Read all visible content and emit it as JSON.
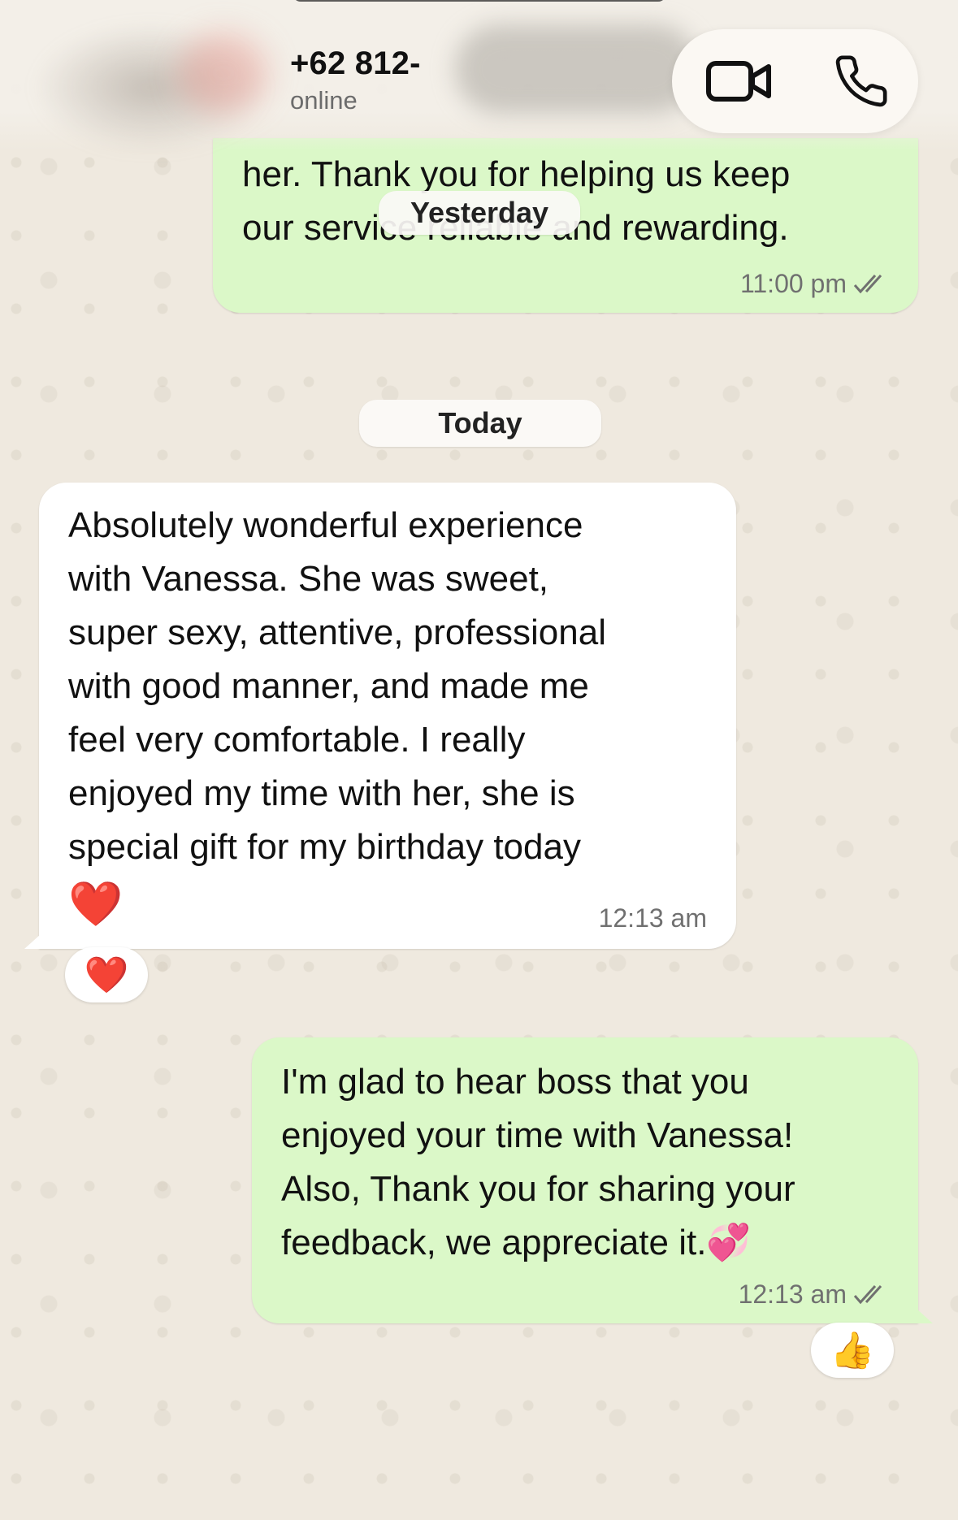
{
  "header": {
    "phone_number": "+62 812-",
    "status": "online",
    "video_icon": "video-camera-icon",
    "phone_icon": "phone-icon"
  },
  "messages": [
    {
      "direction": "outgoing",
      "lines": [
        "her. Thank you for helping us keep",
        "our service reliable and rewarding."
      ],
      "time": "11:00 pm",
      "status_icon": "double-check-icon"
    },
    {
      "direction": "incoming",
      "lines": [
        "Absolutely wonderful experience",
        "with Vanessa. She was sweet,",
        "super sexy, attentive, professional",
        "with good manner, and made me",
        "feel very comfortable. I really",
        "enjoyed my time with her, she is",
        "special gift for my birthday today"
      ],
      "emoji": "❤️",
      "time": "12:13 am",
      "reaction": "❤️"
    },
    {
      "direction": "outgoing",
      "lines": [
        "I'm glad to hear boss that you",
        "enjoyed your time with Vanessa!",
        "Also, Thank you for sharing your",
        "feedback, we appreciate it.💞"
      ],
      "time": "12:13 am",
      "status_icon": "double-check-icon",
      "reaction": "👍"
    }
  ],
  "date_separators": {
    "yesterday": "Yesterday",
    "today": "Today"
  },
  "colors": {
    "outgoing_bubble": "#dbf8c8",
    "incoming_bubble": "#ffffff",
    "wallpaper": "#efe9df",
    "check_color": "#707070"
  }
}
